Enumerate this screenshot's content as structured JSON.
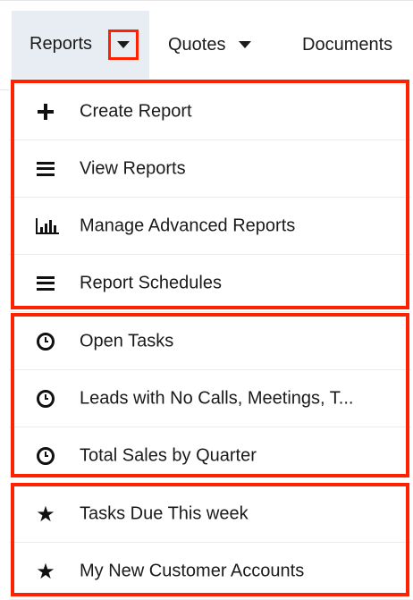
{
  "colors": {
    "highlight": "#ff2200",
    "tab_active_bg": "#e8edf3"
  },
  "nav": {
    "tabs": [
      {
        "label": "Reports",
        "active": true
      },
      {
        "label": "Quotes"
      },
      {
        "label": "Documents"
      }
    ]
  },
  "menu": {
    "groups": [
      {
        "name": "actions",
        "items": [
          {
            "label": "Create Report",
            "icon": "plus-icon"
          },
          {
            "label": "View Reports",
            "icon": "list-icon"
          },
          {
            "label": "Manage Advanced Reports",
            "icon": "bar-chart-icon"
          },
          {
            "label": "Report Schedules",
            "icon": "list-icon"
          }
        ]
      },
      {
        "name": "recently-viewed",
        "items": [
          {
            "label": "Open Tasks",
            "icon": "clock-icon"
          },
          {
            "label": "Leads with No Calls, Meetings, T...",
            "icon": "clock-icon"
          },
          {
            "label": "Total Sales by Quarter",
            "icon": "clock-icon"
          }
        ]
      },
      {
        "name": "favorites",
        "items": [
          {
            "label": "Tasks Due This week",
            "icon": "star-icon"
          },
          {
            "label": "My New Customer Accounts",
            "icon": "star-icon"
          }
        ]
      }
    ]
  }
}
